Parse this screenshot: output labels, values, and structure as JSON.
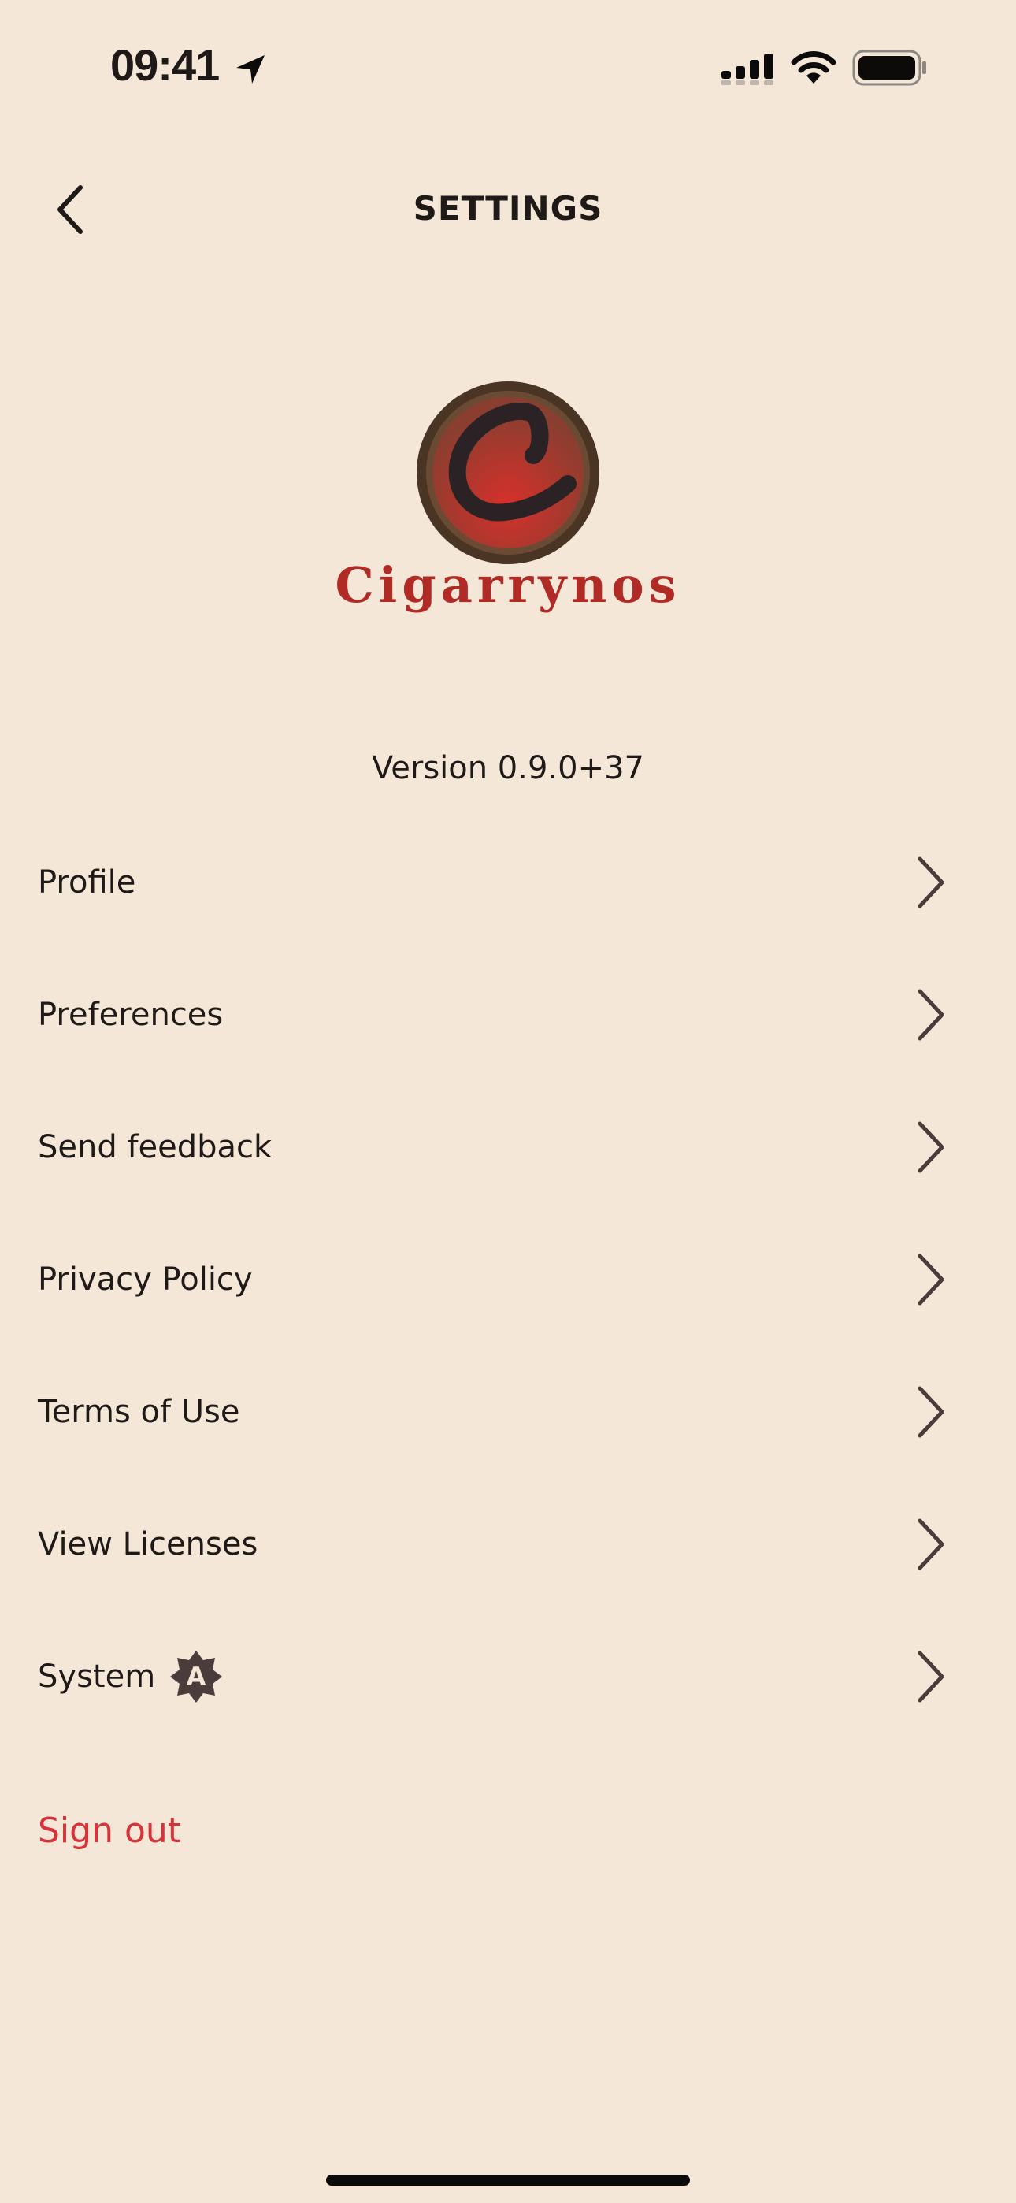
{
  "status_bar": {
    "time": "09:41",
    "icons": [
      "location-arrow-icon",
      "cellular-signal-icon",
      "wifi-icon",
      "battery-icon"
    ]
  },
  "header": {
    "title": "SETTINGS",
    "back_icon": "chevron-left-icon"
  },
  "logo": {
    "wordmark": "Cigarrynos",
    "colors": {
      "ring": "#5a3e2b",
      "inner": "#c9302c",
      "letter": "#2a2224",
      "wordmark": "#b02a26"
    }
  },
  "app": {
    "version": "Version 0.9.0+37"
  },
  "menu": {
    "items": [
      {
        "label": "Profile",
        "icon": "chevron-right-icon"
      },
      {
        "label": "Preferences",
        "icon": "chevron-right-icon"
      },
      {
        "label": "Send feedback",
        "icon": "chevron-right-icon"
      },
      {
        "label": "Privacy Policy",
        "icon": "chevron-right-icon"
      },
      {
        "label": "Terms of Use",
        "icon": "chevron-right-icon"
      },
      {
        "label": "View Licenses",
        "icon": "chevron-right-icon"
      },
      {
        "label": "System",
        "icon": "chevron-right-icon",
        "badge_icon": "auto-theme-icon",
        "badge_letter": "A"
      }
    ]
  },
  "sign_out": {
    "label": "Sign out",
    "color": "#d6343a"
  },
  "theme": {
    "background": "#f5e7d8",
    "text": "#1f1a17",
    "chevron": "#4a3c3a"
  }
}
